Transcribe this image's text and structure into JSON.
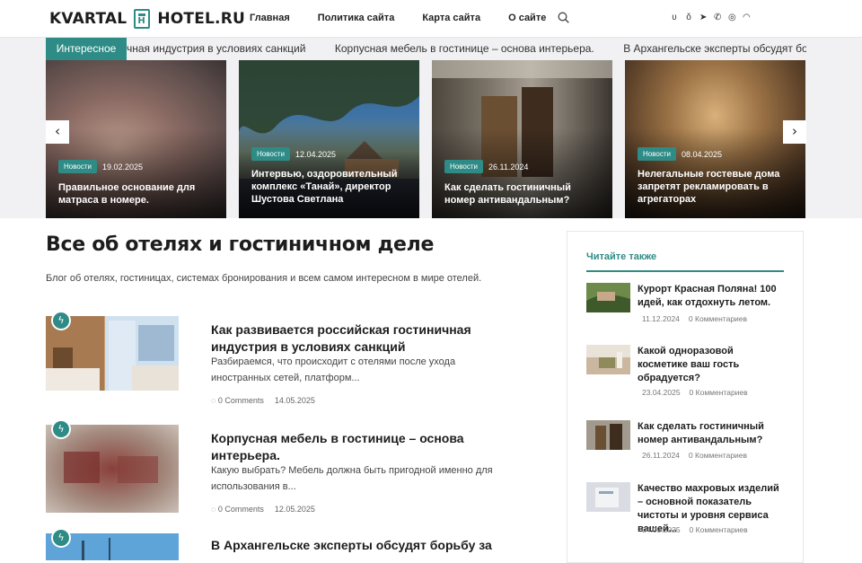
{
  "header": {
    "logo_left": "KVARTAL",
    "logo_right": "HOTEL.RU",
    "nav": [
      "Главная",
      "Политика сайта",
      "Карта сайта",
      "О сайте"
    ],
    "socials": [
      "vk-icon",
      "ok-icon",
      "telegram-icon",
      "viber-icon",
      "whatsapp-icon",
      "rss-icon"
    ]
  },
  "ticker": {
    "label": "Интересное",
    "items": [
      "чная индустрия в условиях санкций",
      "Корпусная мебель в гостинице – основа интерьера.",
      "В Архангельске эксперты обсудят борьбу за"
    ]
  },
  "slider": {
    "slides": [
      {
        "badge": "Новости",
        "date": "19.02.2025",
        "title": "Правильное основание для матраса в номере."
      },
      {
        "badge": "Новости",
        "date": "12.04.2025",
        "title": "Интервью, оздоровительный комплекс «Танай», директор Шустова Светлана"
      },
      {
        "badge": "Новости",
        "date": "26.11.2024",
        "title": "Как сделать гостиничный номер антивандальным?"
      },
      {
        "badge": "Новости",
        "date": "08.04.2025",
        "title": "Нелегальные гостевые дома запретят рекламировать в агрегаторах"
      }
    ],
    "prev": "‹",
    "next": "›"
  },
  "main": {
    "title": "Все об отелях и гостиничном деле",
    "description": "Блог об отелях, гостиницах, системах бронирования и всем самом интересном в мире отелей.",
    "posts": [
      {
        "title": "Как развивается российская гостиничная индустрия в условиях санкций",
        "excerpt": "Разбираемся, что происходит с отелями после ухода иностранных сетей, платформ...",
        "comments": "0 Comments",
        "date": "14.05.2025"
      },
      {
        "title": "Корпусная мебель в гостинице – основа интерьера.",
        "excerpt": "Какую выбрать? Мебель должна быть пригодной именно для использования в...",
        "comments": "0 Comments",
        "date": "12.05.2025"
      },
      {
        "title": "В Архангельске эксперты обсудят борьбу за",
        "excerpt": "",
        "comments": "",
        "date": ""
      }
    ]
  },
  "sidebar": {
    "heading": "Читайте также",
    "items": [
      {
        "title": "Курорт Красная Поляна! 100 идей, как отдохнуть летом.",
        "date": "11.12.2024",
        "comments": "0 Комментариев"
      },
      {
        "title": "Какой одноразовой косметике ваш гость обрадуется?",
        "date": "23.04.2025",
        "comments": "0 Комментариев"
      },
      {
        "title": "Как сделать гостиничный номер антивандальным?",
        "date": "26.11.2024",
        "comments": "0 Комментариев"
      },
      {
        "title": "Качество махровых изделий – основной показатель чистоты и уровня сервиса вашей...",
        "date": "04.03.2025",
        "comments": "0 Комментариев"
      }
    ]
  },
  "colors": {
    "accent": "#2e8b86",
    "ticker_bg": "#f1f1f3"
  }
}
